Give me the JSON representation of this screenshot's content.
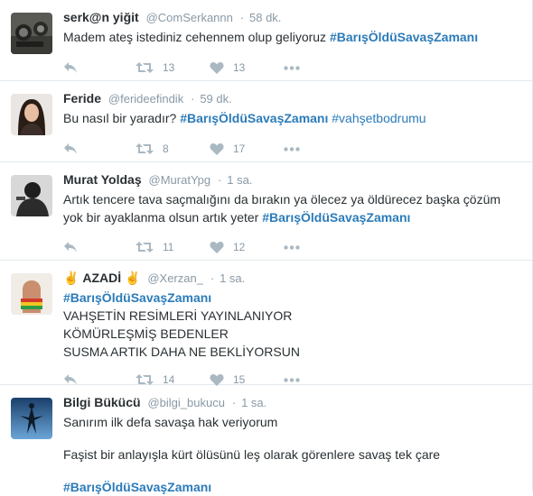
{
  "tweets": [
    {
      "name": "serk@n yiğit",
      "handle": "@ComSerkannn",
      "time": "58 dk.",
      "text_plain": "Madem ateş istediniz cehennem olup geliyoruz",
      "hashtag": "#BarışÖldüSavaşZamanı",
      "retweets": "13",
      "likes": "13"
    },
    {
      "name": "Feride",
      "handle": "@ferideefindik",
      "time": "59 dk.",
      "text_plain": "Bu nasıl bir yaradır?",
      "hashtag": "#BarışÖldüSavaşZamanı",
      "hashtag2": "#vahşetbodrumu",
      "retweets": "8",
      "likes": "17"
    },
    {
      "name": "Murat Yoldaş",
      "handle": "@MuratYpg",
      "time": "1 sa.",
      "line1": "Artık tencere tava saçmalığını da bırakın ya ölecez ya öldürecez başka çözüm",
      "line2": "yok bir ayaklanma olsun artık yeter",
      "hashtag": "#BarışÖldüSavaşZamanı",
      "retweets": "11",
      "likes": "12"
    },
    {
      "name_emoji": "✌",
      "name": "AZADİ",
      "handle": "@Xerzan_",
      "time": "1 sa.",
      "hashtag": "#BarışÖldüSavaşZamanı",
      "line1": "VAHŞETİN RESİMLERİ YAYINLANIYOR",
      "line2": "KÖMÜRLEŞMİŞ BEDENLER",
      "line3": "SUSMA ARTIK DAHA NE BEKLİYORSUN",
      "retweets": "14",
      "likes": "15"
    },
    {
      "name": "Bilgi Bükücü",
      "handle": "@bilgi_bukucu",
      "time": "1 sa.",
      "line1": "Sanırım ilk defa savaşa hak veriyorum",
      "line2": "Faşist bir anlayışla kürt ölüsünü leş olarak görenlere savaş tek çare",
      "hashtag": "#BarışÖldüSavaşZamanı"
    }
  ],
  "separator": "·",
  "icons": {
    "reply": "reply-icon",
    "retweet": "retweet-icon",
    "like": "heart-icon",
    "more": "more-icon"
  },
  "colors": {
    "hashtag": "#2b7bb9",
    "muted": "#8899a6",
    "icon": "#aab8c2",
    "text": "#292f33"
  }
}
